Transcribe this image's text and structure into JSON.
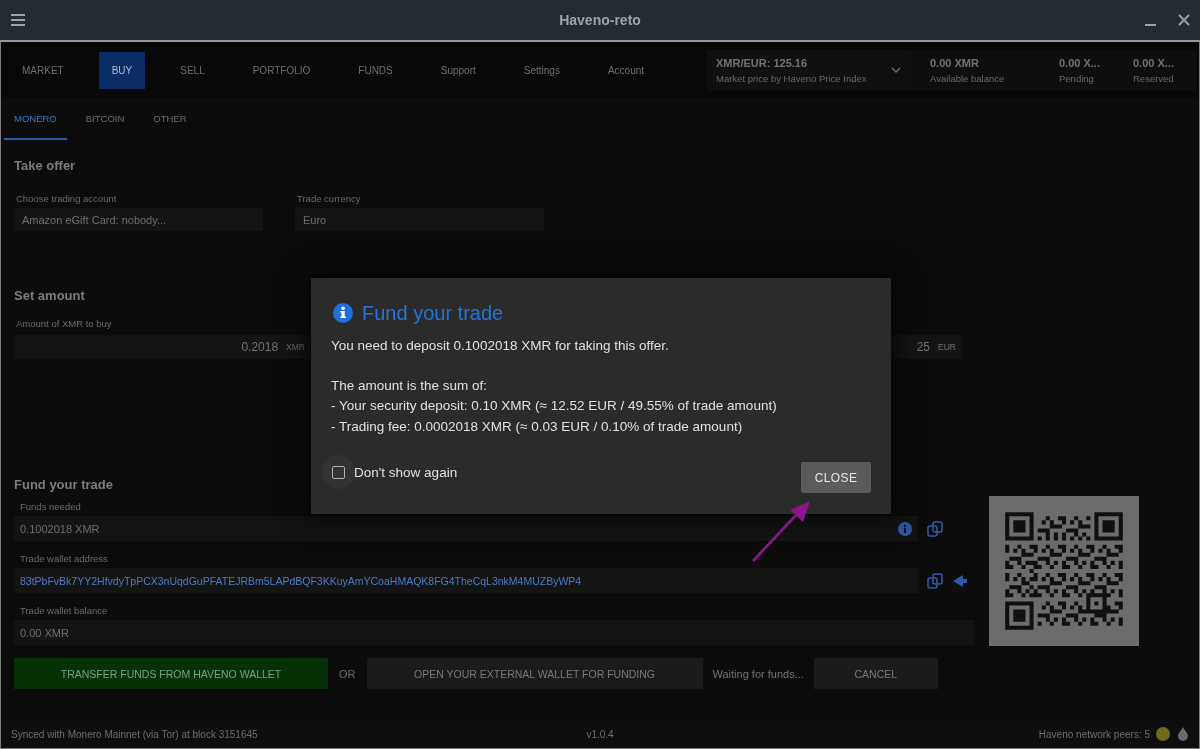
{
  "window": {
    "title": "Haveno-reto"
  },
  "nav": {
    "tabs": [
      {
        "label": "MARKET",
        "selected": false
      },
      {
        "label": "BUY",
        "selected": true
      },
      {
        "label": "SELL",
        "selected": false
      },
      {
        "label": "PORTFOLIO",
        "selected": false
      },
      {
        "label": "FUNDS",
        "selected": false
      },
      {
        "label": "Support",
        "selected": false
      },
      {
        "label": "Settings",
        "selected": false
      },
      {
        "label": "Account",
        "selected": false
      }
    ],
    "market_price": {
      "value": "XMR/EUR: 125.16",
      "caption": "Market price by Haveno Price Index"
    },
    "balances": [
      {
        "value": "0.00 XMR",
        "label": "Available balance"
      },
      {
        "value": "0.00 X...",
        "label": "Pending"
      },
      {
        "value": "0.00 X...",
        "label": "Reserved"
      }
    ]
  },
  "subtabs": [
    {
      "label": "MONERO",
      "selected": true
    },
    {
      "label": "BITCOIN",
      "selected": false
    },
    {
      "label": "OTHER",
      "selected": false
    }
  ],
  "take_offer": {
    "heading": "Take offer",
    "fields": [
      {
        "label": "Choose trading account",
        "value": "Amazon eGift Card: nobody..."
      },
      {
        "label": "Trade currency",
        "value": "Euro"
      }
    ]
  },
  "set_amount": {
    "heading": "Set amount",
    "label": "Amount of XMR to buy",
    "amount": "0.2018",
    "amount_unit": "XMR",
    "volume": "25",
    "volume_unit": "EUR"
  },
  "funding": {
    "heading": "Fund your trade",
    "fields": [
      {
        "kind": "amount",
        "label": "Funds needed",
        "value": "0.1002018 XMR"
      },
      {
        "kind": "address",
        "label": "Trade wallet address",
        "value": "83tPbFvBk7YY2HfvdyTpPCX3nUqdGuPFATEJRBm5LAPdBQF3KKuyAmYCoaHMAQK8FG4TheCqL3nkM4MUZByWP4"
      },
      {
        "kind": "balance",
        "label": "Trade wallet balance",
        "value": "0.00 XMR"
      }
    ],
    "actions": [
      {
        "kind": "primary",
        "label": "TRANSFER FUNDS FROM HAVENO WALLET"
      },
      {
        "kind": "separator",
        "label": "OR"
      },
      {
        "kind": "secondary",
        "label": "OPEN YOUR EXTERNAL WALLET FOR FUNDING"
      },
      {
        "kind": "status",
        "label": "Waiting for funds..."
      },
      {
        "kind": "secondary",
        "label": "CANCEL"
      }
    ]
  },
  "dialog": {
    "title": "Fund your trade",
    "paragraphs": [
      [
        "You need to deposit 0.1002018 XMR for taking this offer."
      ],
      [
        "The amount is the sum of:",
        "- Your security deposit: 0.10 XMR (≈ 12.52 EUR / 49.55% of trade amount)",
        "- Trading fee: 0.0002018 XMR (≈ 0.03 EUR / 0.10% of trade amount)"
      ]
    ],
    "checkbox": {
      "label": "Don't show again",
      "checked": false
    },
    "button": "CLOSE"
  },
  "status_bar": {
    "sync": "Synced with Monero Mainnet (via Tor) at block 3151645",
    "version": "v1.0.4",
    "peers": "Haveno network peers: 5"
  }
}
